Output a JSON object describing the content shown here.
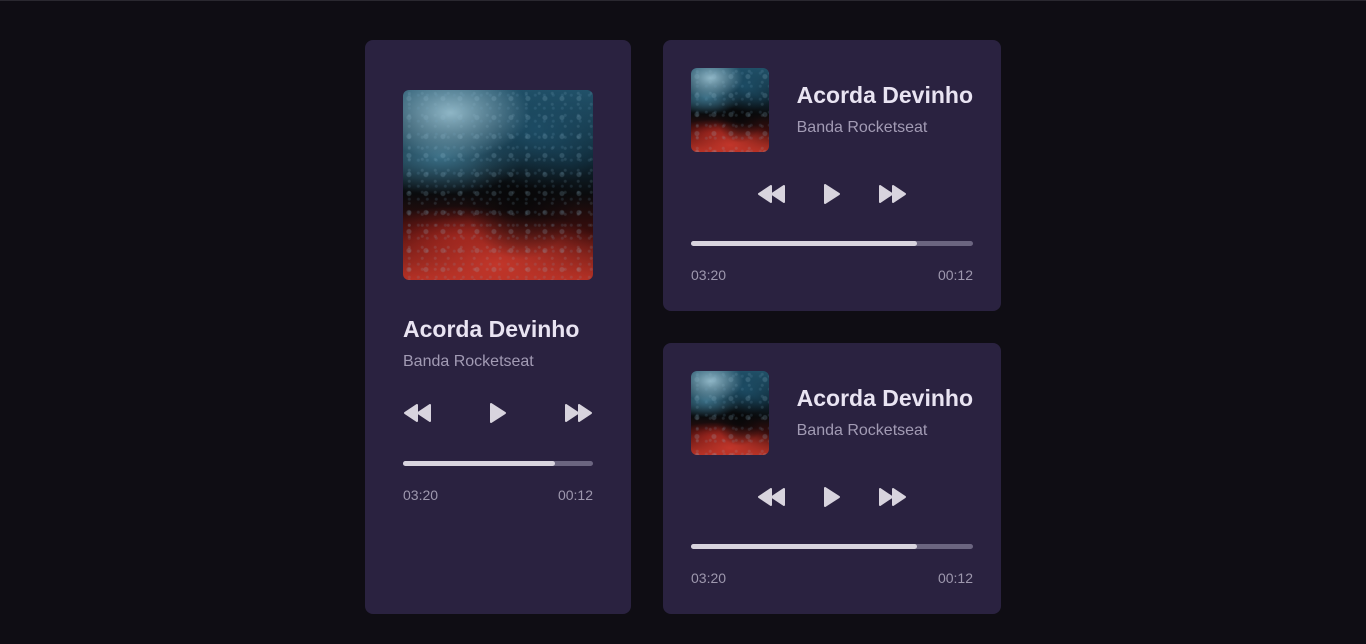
{
  "players": [
    {
      "title": "Acorda Devinho",
      "artist": "Banda Rocketseat",
      "cover_icon": "album-cover-image",
      "progress_fraction": 0.8,
      "time_elapsed": "03:20",
      "time_remaining": "00:12",
      "controls": [
        "rewind-icon",
        "play-icon",
        "fast-forward-icon"
      ]
    },
    {
      "title": "Acorda Devinho",
      "artist": "Banda Rocketseat",
      "cover_icon": "album-cover-image",
      "progress_fraction": 0.8,
      "time_elapsed": "03:20",
      "time_remaining": "00:12",
      "controls": [
        "rewind-icon",
        "play-icon",
        "fast-forward-icon"
      ]
    },
    {
      "title": "Acorda Devinho",
      "artist": "Banda Rocketseat",
      "cover_icon": "album-cover-image",
      "progress_fraction": 0.8,
      "time_elapsed": "03:20",
      "time_remaining": "00:12",
      "controls": [
        "rewind-icon",
        "play-icon",
        "fast-forward-icon"
      ]
    }
  ],
  "colors": {
    "page_background": "#0f0d14",
    "card_background": "#2a2240",
    "title_text": "#e9e4f2",
    "artist_text": "#a29bb4",
    "progress_track": "#6b6580",
    "progress_fill": "#d8d4de",
    "icon": "#d8d4de"
  }
}
